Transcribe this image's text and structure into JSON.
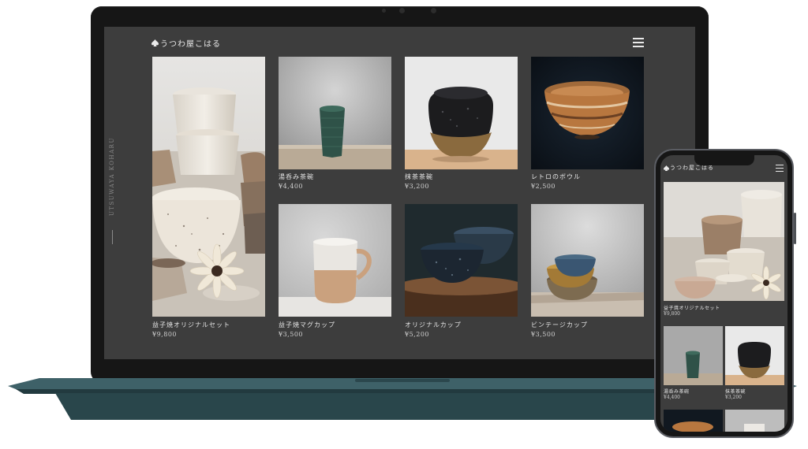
{
  "brand": {
    "logo_text": "うつわ屋こはる",
    "vertical_text": "UTSUWAYA KOHARU"
  },
  "products": [
    {
      "name": "益子焼オリジナルセット",
      "price": "¥9,800"
    },
    {
      "name": "湯呑み茶碗",
      "price": "¥4,400"
    },
    {
      "name": "抹茶茶碗",
      "price": "¥3,200"
    },
    {
      "name": "レトロのボウル",
      "price": "¥2,500"
    },
    {
      "name": "益子焼マグカップ",
      "price": "¥3,500"
    },
    {
      "name": "オリジナルカップ",
      "price": "¥5,200"
    },
    {
      "name": "ビンテージカップ",
      "price": "¥3,500"
    }
  ],
  "icons": {
    "menu": "hamburger-menu-icon",
    "logo_mark": "spade-icon"
  },
  "colors": {
    "screen_bg": "#3d3d3d",
    "device_frame": "#161616",
    "laptop_base": "#2e4a4f"
  }
}
